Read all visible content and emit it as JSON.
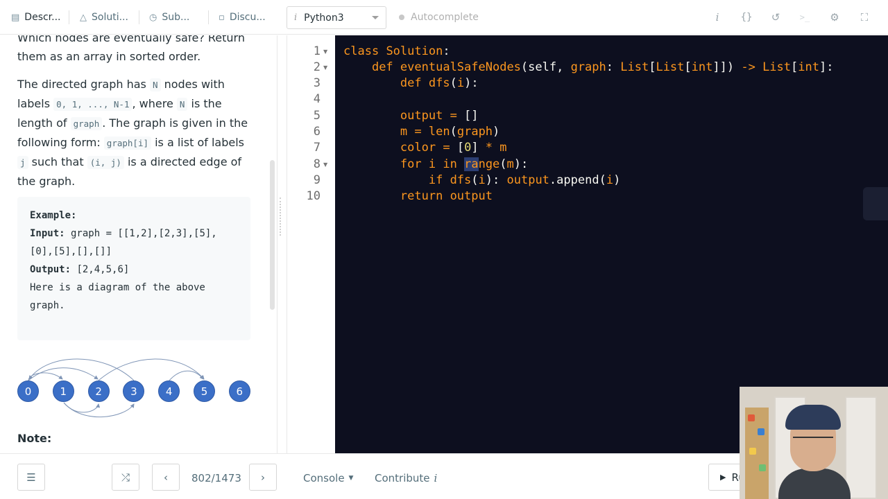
{
  "tabs": [
    {
      "label": "Descr...",
      "icon": "description-icon"
    },
    {
      "label": "Soluti...",
      "icon": "flask-icon"
    },
    {
      "label": "Sub...",
      "icon": "clock-icon"
    },
    {
      "label": "Discu...",
      "icon": "discuss-icon"
    }
  ],
  "language": {
    "value": "Python3"
  },
  "autocomplete_label": "Autocomplete",
  "description": {
    "p0_line1": "Which nodes are eventually safe? Return",
    "p0_line2": "them as an array in sorted order.",
    "p1": {
      "t1": "The directed graph has ",
      "c1": "N",
      "t2": " nodes with labels ",
      "c2": "0, 1, ..., N-1",
      "t3": ", where ",
      "c3": "N",
      "t4": " is the length of ",
      "c4": "graph",
      "t5": ". The graph is given in the following form: ",
      "c5": "graph[i]",
      "t6": " is a list of labels ",
      "c6": "j",
      "t7": " such that ",
      "c7": "(i, j)",
      "t8": " is a directed edge of the graph."
    },
    "example": {
      "heading": "Example:",
      "input_label": "Input:",
      "input_line1": " graph = [[1,2],[2,3],[5],",
      "input_line2": "[0],[5],[],[]]",
      "output_label": "Output:",
      "output_value": " [2,4,5,6]",
      "note_line1": "Here is a diagram of the above",
      "note_line2": "graph."
    },
    "graph_nodes": [
      "0",
      "1",
      "2",
      "3",
      "4",
      "5",
      "6"
    ],
    "note_heading": "Note:"
  },
  "editor": {
    "line_numbers": [
      "1",
      "2",
      "3",
      "4",
      "5",
      "6",
      "7",
      "8",
      "9",
      "10"
    ],
    "code_lines": [
      "class Solution:",
      "    def eventualSafeNodes(self, graph: List[List[int]]) -> List[int]:",
      "        def dfs(i):",
      "",
      "        output = []",
      "        m = len(graph)",
      "        color = [0] * m",
      "        for i in range(m):",
      "            if dfs(i): output.append(i)",
      "        return output"
    ]
  },
  "bottom": {
    "page_indicator": "802/1473",
    "console_label": "Console",
    "contribute_label": "Contribute",
    "run_label": "Run"
  },
  "colors": {
    "editor_bg": "#0d0f1f",
    "keyword": "#fd971f",
    "graph_node": "#3b6fc7",
    "selection": "#2c3e73"
  }
}
